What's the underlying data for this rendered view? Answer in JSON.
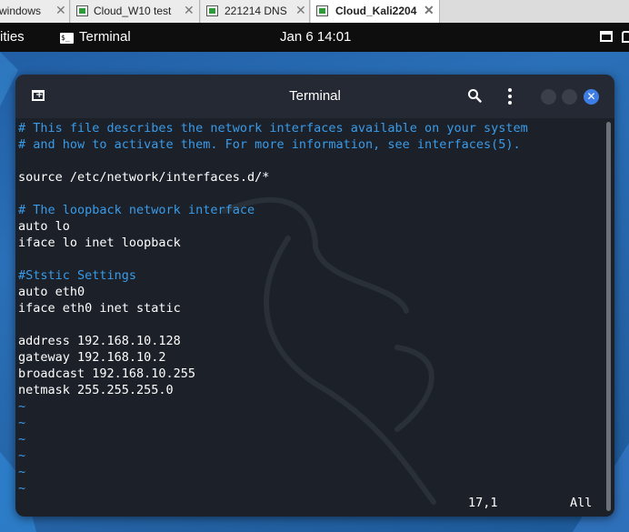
{
  "host_tabs": [
    {
      "label": "windows"
    },
    {
      "label": "Cloud_W10 test"
    },
    {
      "label": "221214 DNS"
    },
    {
      "label": "Cloud_Kali2204",
      "active": true
    }
  ],
  "top_panel": {
    "activities": "ities",
    "app_name": "Terminal",
    "app_icon_text": "$_",
    "clock": "Jan 6  14:01"
  },
  "window": {
    "title": "Terminal"
  },
  "editor": {
    "lines": [
      {
        "text": "# This file describes the network interfaces available on your system",
        "kind": "comment"
      },
      {
        "text": "# and how to activate them. For more information, see interfaces(5).",
        "kind": "comment"
      },
      {
        "text": "",
        "kind": "text"
      },
      {
        "text": "source /etc/network/interfaces.d/*",
        "kind": "text"
      },
      {
        "text": "",
        "kind": "text"
      },
      {
        "text": "# The loopback network interface",
        "kind": "comment"
      },
      {
        "text": "auto lo",
        "kind": "text"
      },
      {
        "text": "iface lo inet loopback",
        "kind": "text"
      },
      {
        "text": "",
        "kind": "text"
      },
      {
        "text": "#Ststic Settings",
        "kind": "comment"
      },
      {
        "text": "auto eth0",
        "kind": "text"
      },
      {
        "text": "iface eth0 inet static",
        "kind": "text"
      },
      {
        "text": "",
        "kind": "text"
      },
      {
        "text": "address 192.168.10.128",
        "kind": "text"
      },
      {
        "text": "gateway 192.168.10.2",
        "kind": "text"
      },
      {
        "text": "broadcast 192.168.10.255",
        "kind": "text"
      },
      {
        "text": "netmask 255.255.255.0",
        "kind": "text"
      },
      {
        "text": "~",
        "kind": "tilde"
      },
      {
        "text": "~",
        "kind": "tilde"
      },
      {
        "text": "~",
        "kind": "tilde"
      },
      {
        "text": "~",
        "kind": "tilde"
      },
      {
        "text": "~",
        "kind": "tilde"
      },
      {
        "text": "~",
        "kind": "tilde"
      }
    ],
    "cursor_position": "17,1",
    "scroll_position": "All"
  },
  "colors": {
    "comment": "#3a9be8",
    "close_button": "#3d7de4"
  }
}
